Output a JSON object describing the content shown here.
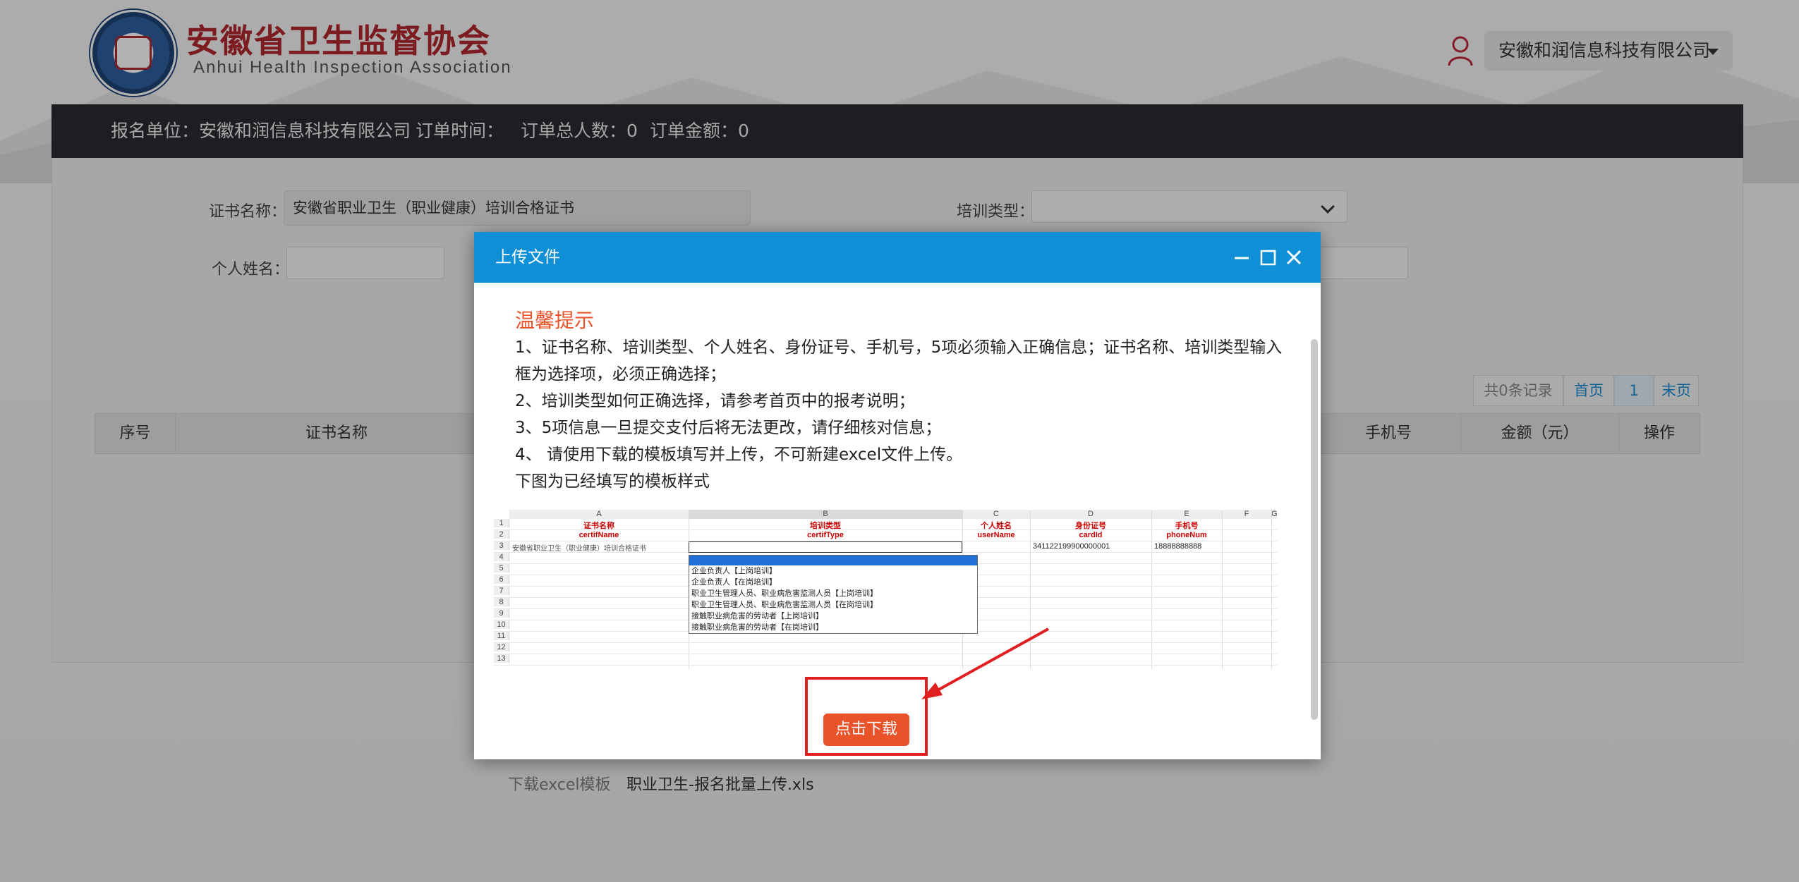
{
  "header": {
    "site_title": "安徽省卫生监督协会",
    "site_subtitle": "Anhui  Health  Inspection  Association",
    "user_name": "安徽和润信息科技有限公司"
  },
  "order_bar": {
    "unit": "报名单位：安徽和润信息科技有限公司",
    "time": "订单时间：",
    "total_people": "订单总人数：0",
    "amount": "订单金额：0"
  },
  "form": {
    "cert_name_label": "证书名称：",
    "cert_name_value": "安徽省职业卫生（职业健康）培训合格证书",
    "train_type_label": "培训类型：",
    "name_label": "个人姓名："
  },
  "pager": {
    "records": "共0条记录",
    "first": "首页",
    "page": "1",
    "last": "末页"
  },
  "table": {
    "columns": [
      "序号",
      "证书名称",
      "手机号",
      "金额（元）",
      "操作"
    ]
  },
  "modal": {
    "title": "上传文件",
    "tip_title": "温馨提示",
    "tips": [
      "1、证书名称、培训类型、个人姓名、身份证号、手机号，5项必须输入正确信息；证书名称、培训类型输入",
      "框为选择项，必须正确选择；",
      "2、培训类型如何正确选择，请参考首页中的报考说明；",
      "3、5项信息一旦提交支付后将无法更改，请仔细核对信息；",
      "4、  请使用下载的模板填写并上传，不可新建excel文件上传。",
      "下图为已经填写的模板样式"
    ],
    "sheet": {
      "col_letters": [
        "A",
        "B",
        "C",
        "D",
        "E",
        "F",
        "G"
      ],
      "row_numbers": [
        "1",
        "2",
        "3",
        "4",
        "5",
        "6",
        "7",
        "8",
        "9",
        "10",
        "11",
        "12",
        "13"
      ],
      "headers_cn": [
        "证书名称",
        "培训类型",
        "个人姓名",
        "身份证号",
        "手机号"
      ],
      "headers_en": [
        "certifName",
        "certifType",
        "userName",
        "cardId",
        "phoneNum"
      ],
      "row3": [
        "安徽省职业卫生（职业健康）培训合格证书",
        "341122199900000001",
        "18888888888"
      ],
      "dropdown_options": [
        "企业负责人【上岗培训】",
        "企业负责人【在岗培训】",
        "职业卫生管理人员、职业病危害监测人员【上岗培训】",
        "职业卫生管理人员、职业病危害监测人员【在岗培训】",
        "接触职业病危害的劳动者【上岗培训】",
        "接触职业病危害的劳动者【在岗培训】"
      ]
    },
    "download_label": "下载excel模板",
    "download_file": "职业卫生-报名批量上传.xls",
    "download_button": "点击下载"
  },
  "colors": {
    "brand_red": "#b2282f",
    "modal_header": "#0f8fd6",
    "accent_orange": "#e8532a",
    "highlight_red": "#e02020",
    "dark_bar": "#2c2c31"
  }
}
